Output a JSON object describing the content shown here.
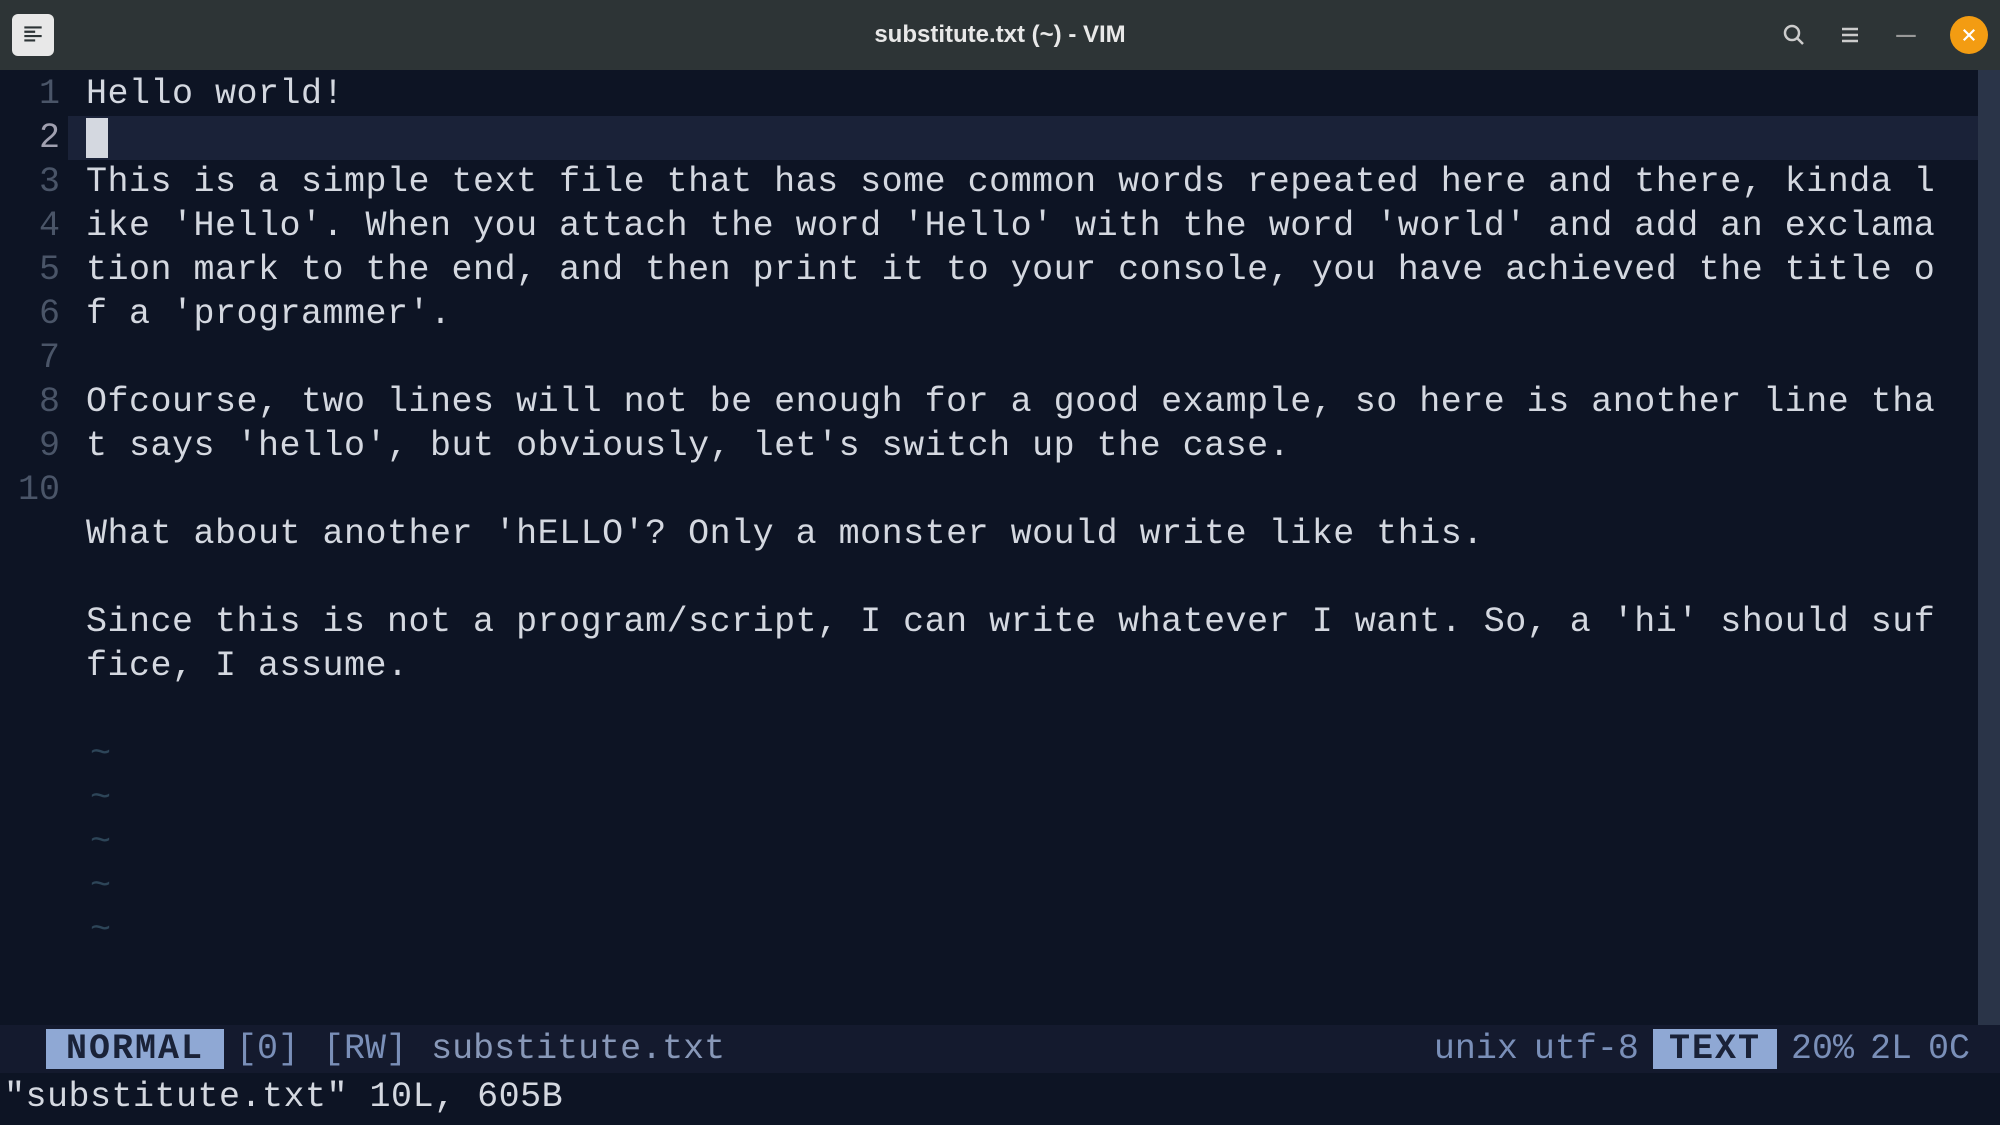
{
  "window": {
    "title": "substitute.txt (~) - VIM"
  },
  "editor": {
    "lines": [
      {
        "num": "1",
        "text": "Hello world!",
        "current": false
      },
      {
        "num": "2",
        "text": "",
        "current": true,
        "cursor": true
      },
      {
        "num": "3",
        "text": "This is a simple text file that has some common words repeated here and there, kinda l",
        "current": false
      },
      {
        "num": "",
        "text": "ike 'Hello'. When you attach the word 'Hello' with the word 'world' and add an exclama",
        "current": false,
        "wrap": true
      },
      {
        "num": "",
        "text": "tion mark to the end, and then print it to your console, you have achieved the title o",
        "current": false,
        "wrap": true
      },
      {
        "num": "",
        "text": "f a 'programmer'.",
        "current": false,
        "wrap": true
      },
      {
        "num": "4",
        "text": "",
        "current": false
      },
      {
        "num": "5",
        "text": "Ofcourse, two lines will not be enough for a good example, so here is another line tha",
        "current": false
      },
      {
        "num": "",
        "text": "t says 'hello', but obviously, let's switch up the case.",
        "current": false,
        "wrap": true
      },
      {
        "num": "6",
        "text": "",
        "current": false
      },
      {
        "num": "7",
        "text": "What about another 'hELLO'? Only a monster would write like this.",
        "current": false
      },
      {
        "num": "8",
        "text": "",
        "current": false
      },
      {
        "num": "9",
        "text": "Since this is not a program/script, I can write whatever I want. So, a 'hi' should suf",
        "current": false
      },
      {
        "num": "",
        "text": "fice, I assume.",
        "current": false,
        "wrap": true
      },
      {
        "num": "10",
        "text": "",
        "current": false
      }
    ],
    "tilde_count": 5
  },
  "status": {
    "mode": "NORMAL",
    "modified": "[0]",
    "readwrite": "[RW]",
    "filename": "substitute.txt",
    "fileformat": "unix",
    "encoding": "utf-8",
    "filetype": "TEXT",
    "percent": "20%",
    "line": "2L",
    "col": "0C",
    "message": "\"substitute.txt\" 10L, 605B"
  }
}
